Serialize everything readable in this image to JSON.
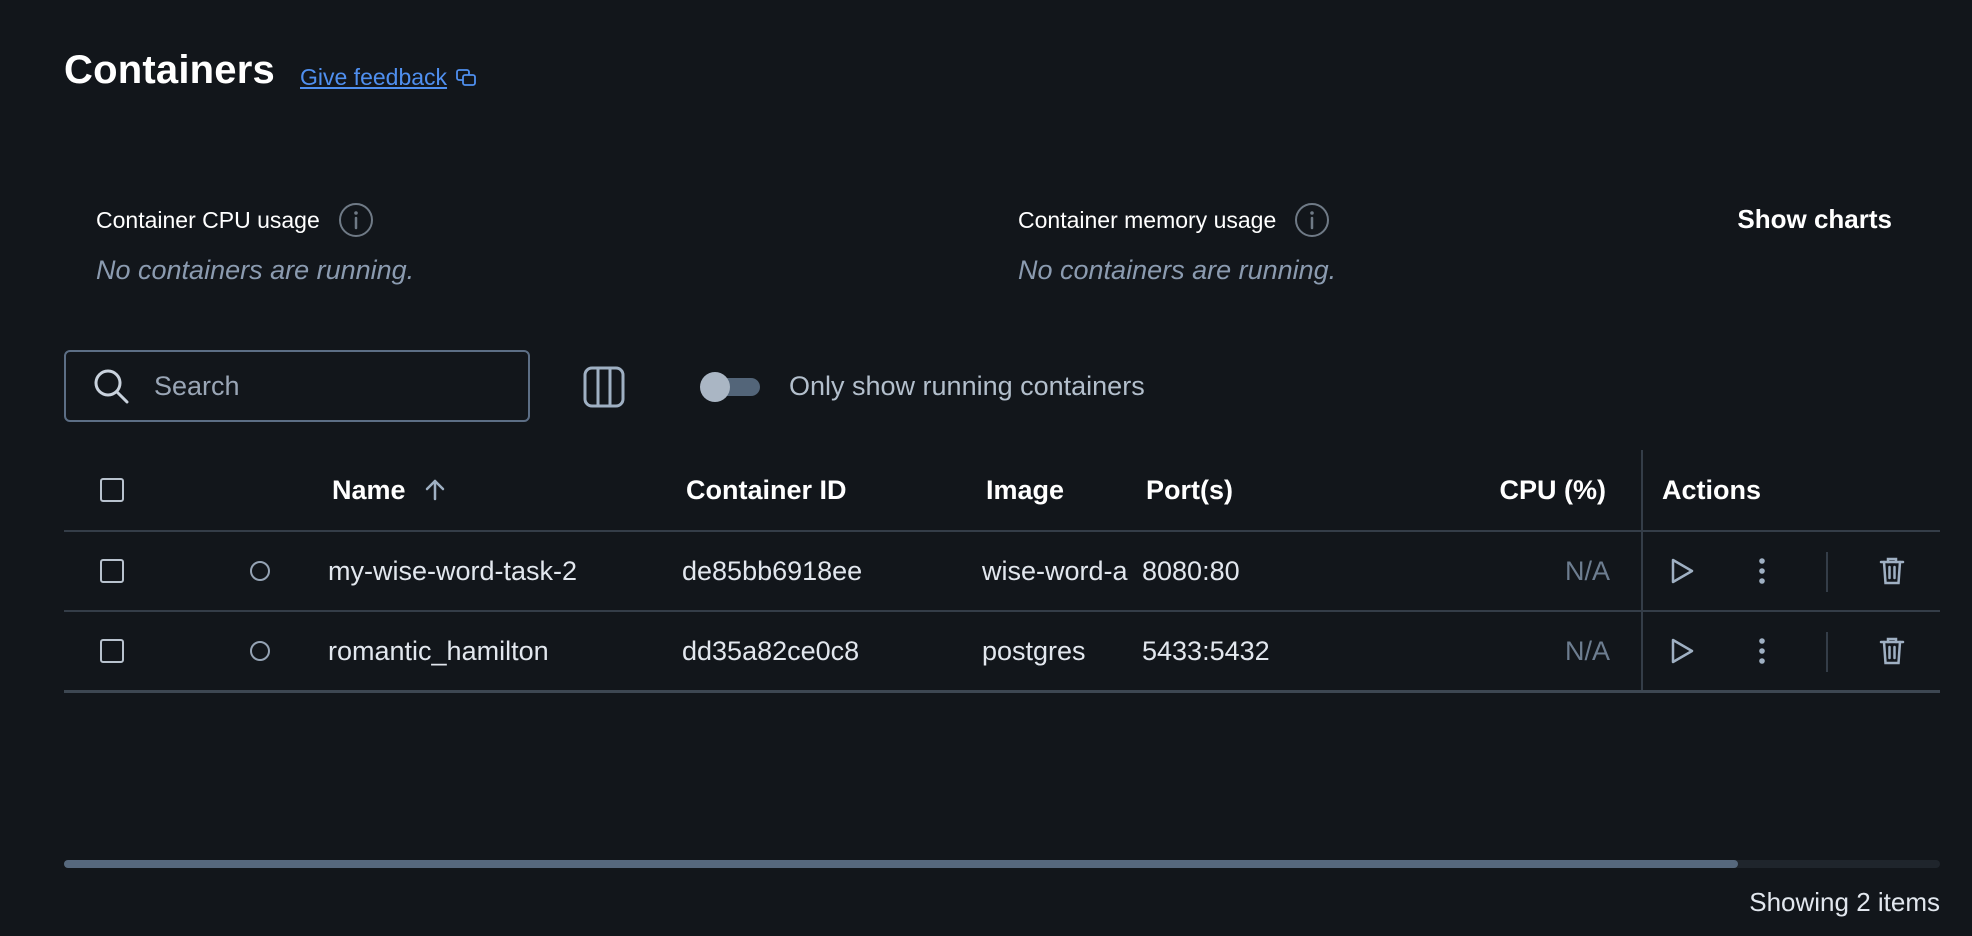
{
  "header": {
    "title": "Containers",
    "feedback_label": "Give feedback"
  },
  "usage": {
    "cpu_label": "Container CPU usage",
    "cpu_empty": "No containers are running.",
    "memory_label": "Container memory usage",
    "memory_empty": "No containers are running.",
    "show_charts_label": "Show charts"
  },
  "toolbar": {
    "search_placeholder": "Search",
    "search_value": "",
    "toggle_label": "Only show running containers",
    "toggle_on": false
  },
  "table": {
    "columns": {
      "name": "Name",
      "container_id": "Container ID",
      "image": "Image",
      "ports": "Port(s)",
      "cpu": "CPU (%)",
      "actions": "Actions"
    },
    "sort": {
      "column": "Name",
      "direction": "ascending"
    },
    "rows": [
      {
        "name": "my-wise-word-task-2",
        "container_id": "de85bb6918ee",
        "image": "wise-word-api",
        "ports": "8080:80",
        "cpu": "N/A",
        "status": "stopped"
      },
      {
        "name": "romantic_hamilton",
        "container_id": "dd35a82ce0c8",
        "image": "postgres",
        "ports": "5433:5432",
        "cpu": "N/A",
        "status": "stopped"
      }
    ]
  },
  "icons": {
    "feedback": "feedback-icon",
    "info": "info-icon",
    "search": "search-icon",
    "columns": "columns-icon",
    "sort": "arrow-up-icon",
    "start": "play-icon",
    "more": "more-vertical-icon",
    "delete": "trash-icon"
  },
  "colors": {
    "background": "#12161b",
    "link": "#4f8fef",
    "muted_text": "#8b9bb0",
    "border": "#343d48"
  },
  "scroll": {
    "horizontal_thumb_fraction": 0.89
  },
  "footer": {
    "count_label": "Showing 2 items"
  }
}
